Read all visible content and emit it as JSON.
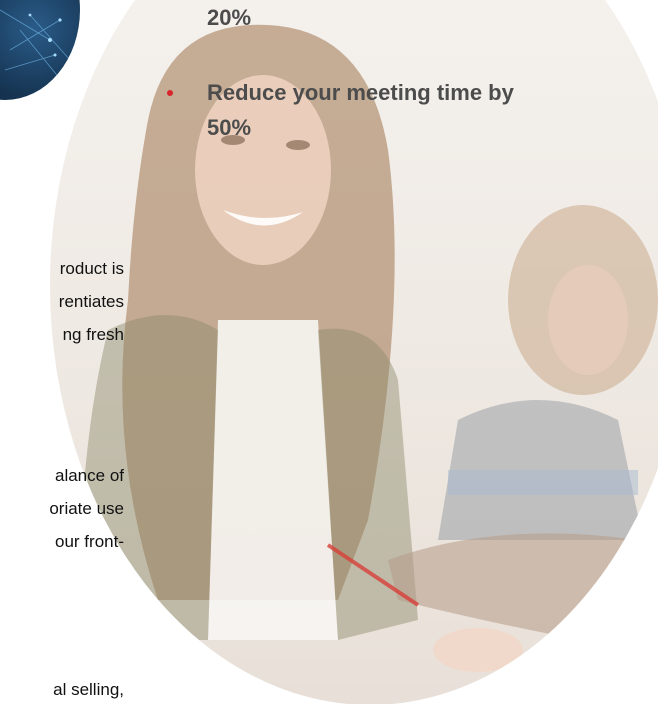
{
  "bullets": {
    "item1_tail": "20%",
    "item2_line1": "Reduce your meeting time by",
    "item2_line2": "50%"
  },
  "left_text": {
    "para1": [
      "roduct is",
      "rentiates",
      "ng fresh"
    ],
    "para2": [
      "alance of",
      "oriate use",
      "our front-"
    ],
    "para3": [
      "al selling,"
    ]
  },
  "colors": {
    "bullet": "#d8262c",
    "bullet_text": "#4c4c4c",
    "body_text": "#111111"
  },
  "icons": {
    "bullet_marker": "red-dot-icon"
  }
}
